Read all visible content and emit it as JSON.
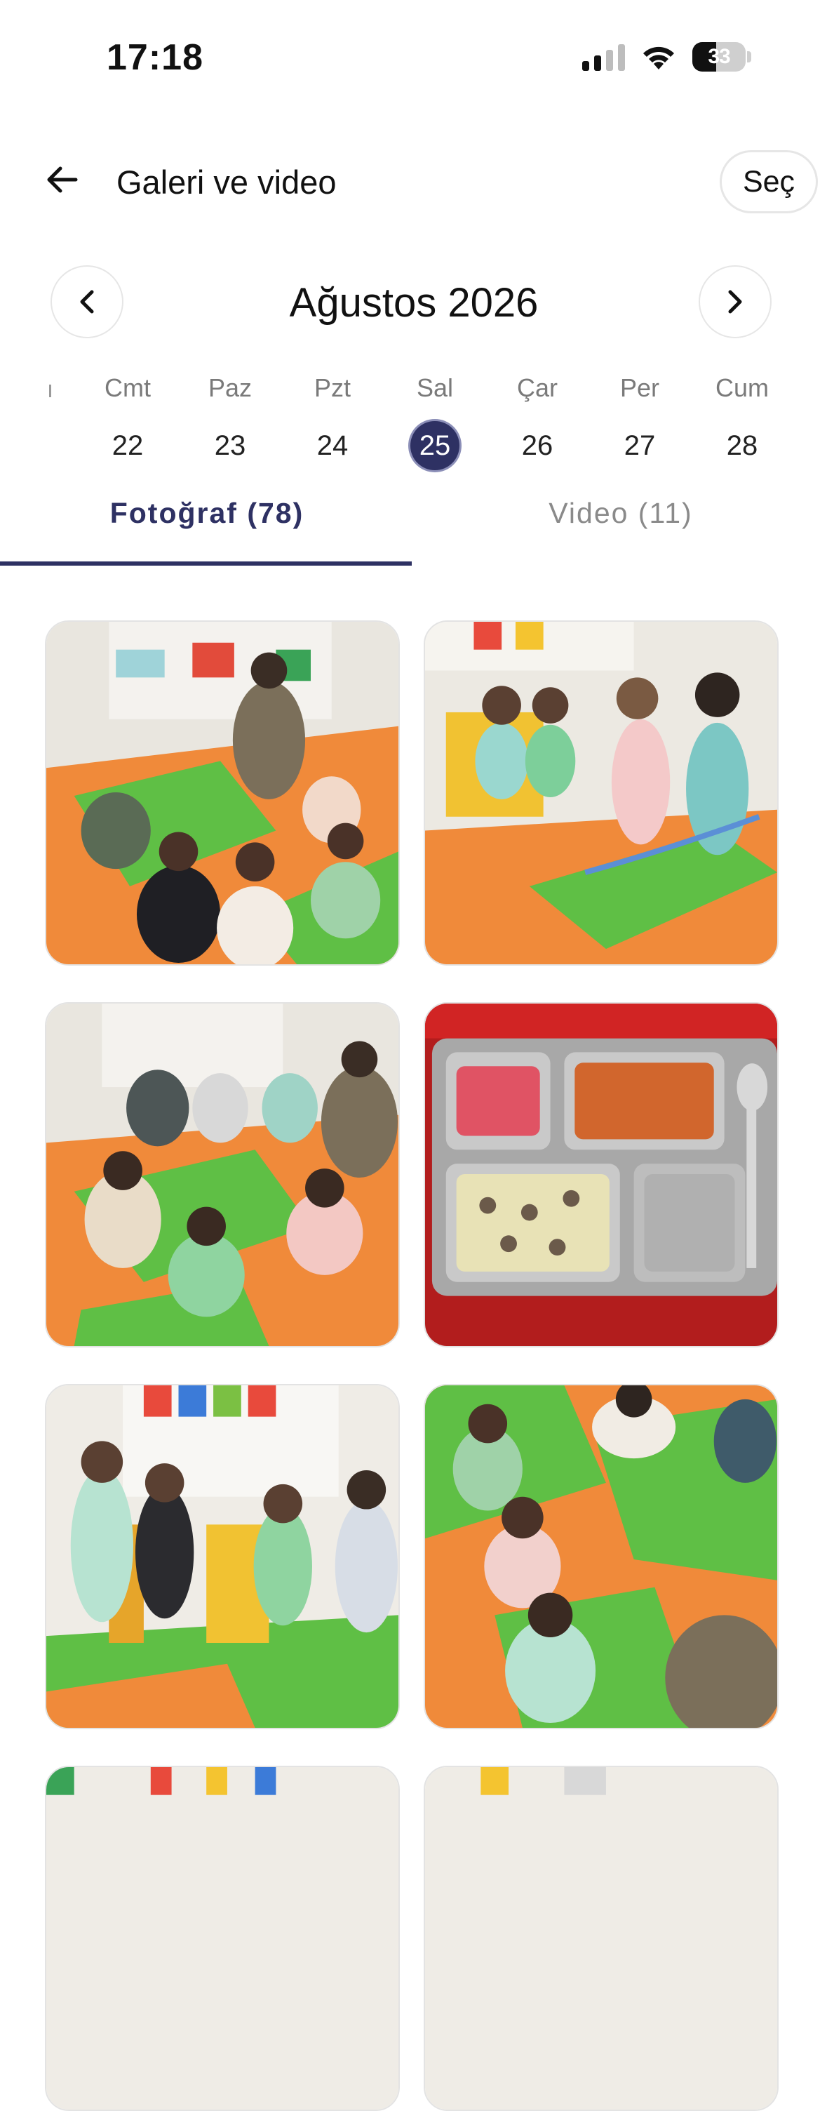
{
  "status": {
    "time": "17:18",
    "battery": "33",
    "icons": [
      "signal-icon",
      "wifi-icon",
      "battery-icon"
    ]
  },
  "header": {
    "title": "Galeri ve video",
    "back_icon": "back-arrow-icon",
    "select_label": "Seç"
  },
  "calendar": {
    "month_label": "Ağustos 2026",
    "prev_icon": "chevron-left-icon",
    "next_icon": "chevron-right-icon",
    "days": [
      {
        "name": "Cmt",
        "num": "22"
      },
      {
        "name": "Paz",
        "num": "23"
      },
      {
        "name": "Pzt",
        "num": "24"
      },
      {
        "name": "Sal",
        "num": "25"
      },
      {
        "name": "Çar",
        "num": "26"
      },
      {
        "name": "Per",
        "num": "27"
      },
      {
        "name": "Cum",
        "num": "28"
      }
    ],
    "selected_day": "25",
    "accent_color": "#2e3163"
  },
  "tabs": {
    "photo": "Fotoğraf (78)",
    "video": "Video (11)",
    "active": "photo"
  },
  "gallery": {
    "thumbnails": [
      "classroom-circle-photo",
      "children-walking-photo",
      "classroom-circle-photo",
      "lunch-tray-photo",
      "children-chairs-photo",
      "children-floor-photo"
    ]
  }
}
